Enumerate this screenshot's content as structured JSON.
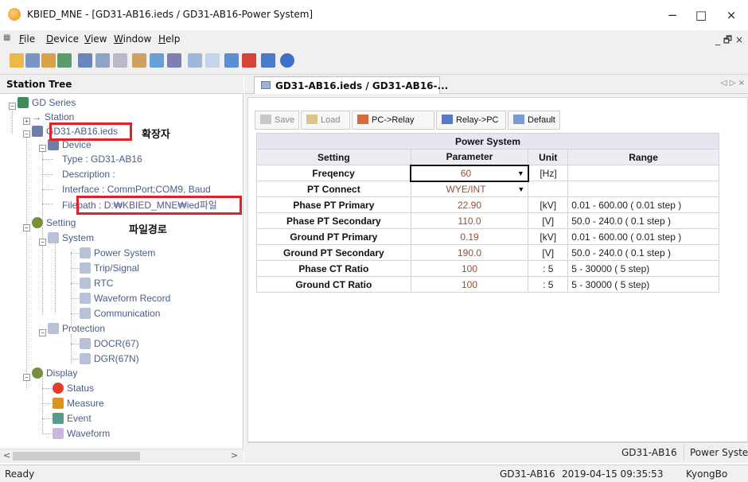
{
  "window": {
    "title": "KBIED_MNE - [GD31-AB16.ieds / GD31-AB16-Power System]",
    "controls": {
      "minimize": "−",
      "maximize": "□",
      "close": "×"
    }
  },
  "menu": {
    "items": [
      {
        "label": "File",
        "mnemonic": "F",
        "rest": "ile"
      },
      {
        "label": "Device",
        "mnemonic": "D",
        "rest": "evice"
      },
      {
        "label": "View",
        "mnemonic": "V",
        "rest": "iew"
      },
      {
        "label": "Window",
        "mnemonic": "W",
        "rest": "indow"
      },
      {
        "label": "Help",
        "mnemonic": "H",
        "rest": "elp"
      }
    ],
    "mdi_controls": "_ 🗗 ×"
  },
  "toolbar": {
    "icons": [
      "open-icon",
      "save-icon",
      "connect-icon",
      "network-icon",
      "tree-icon",
      "relay-icon",
      "settings-icon",
      "camera-icon",
      "monitor-icon",
      "grid-icon",
      "window-icon",
      "wave-icon",
      "chart-icon",
      "export-icon",
      "delete-icon",
      "help-icon"
    ]
  },
  "station_tree": {
    "title": "Station Tree",
    "root": "GD Series",
    "station": "Station",
    "ieds_file": "GD31-AB16.ieds",
    "device": "Device",
    "type": "Type : GD31-AB16",
    "description": "Description :",
    "interface": "Interface : CommPort;COM9, Baud",
    "filepath": "Filepath : D:₩KBIED_MNE₩ied파일",
    "setting": "Setting",
    "system": "System",
    "system_items": [
      "Power System",
      "Trip/Signal",
      "RTC",
      "Waveform Record",
      "Communication"
    ],
    "protection": "Protection",
    "protection_items": [
      "DOCR(67)",
      "DGR(67N)"
    ],
    "display": "Display",
    "display_items": [
      "Status",
      "Measure",
      "Event",
      "Waveform"
    ]
  },
  "annotations": {
    "extension": "확장자",
    "filepath": "파일경로"
  },
  "document": {
    "tab_label": "GD31-AB16.ieds / GD31-AB16-...",
    "tab_nav": "◁ ▷ ×",
    "buttons": {
      "save": "Save",
      "load": "Load",
      "pc_to_relay": "PC->Relay",
      "relay_to_pc": "Relay->PC",
      "default": "Default"
    },
    "table": {
      "caption": "Power System",
      "headers": [
        "Setting",
        "Parameter",
        "Unit",
        "Range"
      ],
      "rows": [
        {
          "setting": "Freqency",
          "parameter": "60",
          "unit": "[Hz]",
          "range": "",
          "dropdown": true
        },
        {
          "setting": "PT Connect",
          "parameter": "WYE/INT",
          "unit": "",
          "range": "",
          "dropdown": true
        },
        {
          "setting": "Phase PT Primary",
          "parameter": "22.90",
          "unit": "[kV]",
          "range": "0.01 - 600.00 ( 0.01 step )"
        },
        {
          "setting": "Phase PT Secondary",
          "parameter": "110.0",
          "unit": "[V]",
          "range": "50.0 - 240.0 ( 0.1 step )"
        },
        {
          "setting": "Ground PT Primary",
          "parameter": "0.19",
          "unit": "[kV]",
          "range": "0.01 - 600.00 ( 0.01 step )"
        },
        {
          "setting": "Ground PT Secondary",
          "parameter": "190.0",
          "unit": "[V]",
          "range": "50.0 - 240.0 ( 0.1 step )"
        },
        {
          "setting": "Phase CT Ratio",
          "parameter": "100",
          "unit": ": 5",
          "range": "5 - 30000 ( 5 step)"
        },
        {
          "setting": "Ground CT Ratio",
          "parameter": "100",
          "unit": ": 5",
          "range": "5 - 30000 ( 5 step)"
        }
      ]
    },
    "status_device": "GD31-AB16",
    "status_view": "Power System"
  },
  "statusbar": {
    "ready": "Ready",
    "device": "GD31-AB16",
    "datetime": "2019-04-15 09:35:53",
    "user": "KyongBo"
  }
}
